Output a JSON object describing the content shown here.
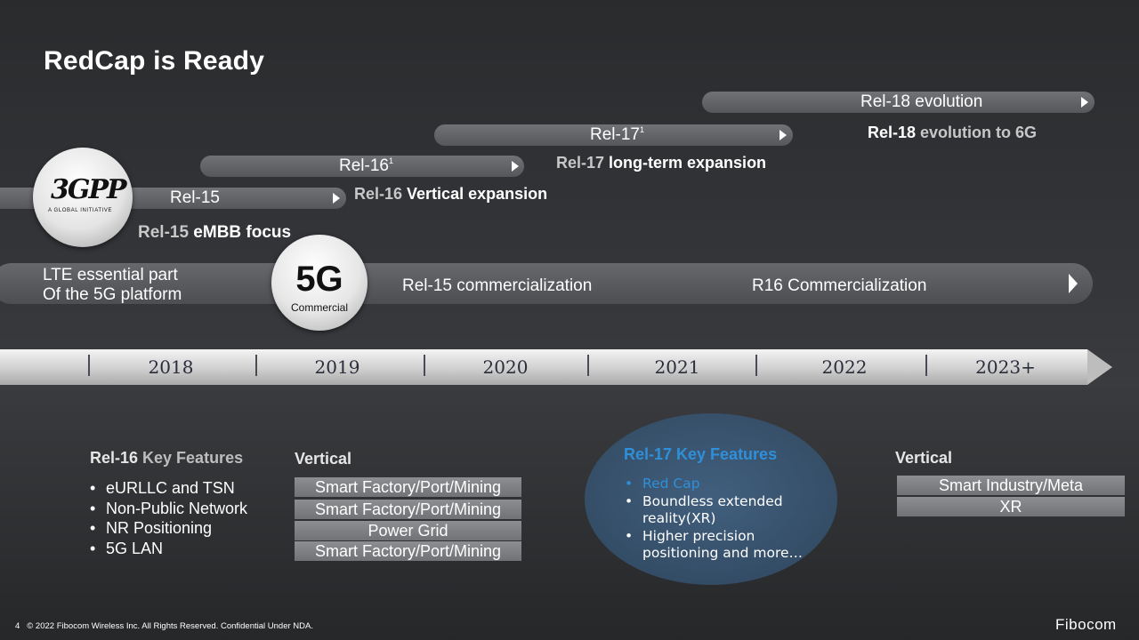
{
  "title": "RedCap is Ready",
  "bars": {
    "rel18": "Rel-18 evolution",
    "rel17": "Rel-17",
    "rel17_sup": "1",
    "rel16": "Rel-16",
    "rel16_sup": "1",
    "rel15": "Rel-15"
  },
  "subtitles": {
    "rel18_prefix": "Rel-18",
    "rel18_text": " evolution to 6G",
    "rel17_prefix": "Rel-17",
    "rel17_text": " long-term expansion",
    "rel16_prefix": "Rel-16",
    "rel16_text": " Vertical expansion",
    "rel15_prefix": "Rel-15",
    "rel15_text": " eMBB focus"
  },
  "logo_3gpp": {
    "mark": "3GPP",
    "tagline": "A GLOBAL INITIATIVE"
  },
  "circle_5g": {
    "big": "5G",
    "small": "Commercial"
  },
  "commercial_bar": {
    "lte_line1": "LTE essential part",
    "lte_line2": "Of the 5G platform",
    "rel15_comm": "Rel-15 commercialization",
    "r16_comm": "R16 Commercialization"
  },
  "timeline": {
    "years": [
      "2018",
      "2019",
      "2020",
      "2021",
      "2022",
      "2023+"
    ]
  },
  "rel16_features": {
    "head_prefix": "Rel-16",
    "head_text": " Key Features",
    "items": [
      "eURLLC and TSN",
      "Non-Public Network",
      "NR Positioning",
      "5G LAN"
    ]
  },
  "vertical_left": {
    "head": "Vertical",
    "boxes": [
      "Smart Factory/Port/Mining",
      "Smart Factory/Port/Mining",
      "Power Grid",
      "Smart Factory/Port/Mining"
    ]
  },
  "rel17_features": {
    "head": "Rel-17 Key Features",
    "item1": "Red Cap",
    "item2_l1": "Boundless extended",
    "item2_l2": "reality(XR)",
    "item3_l1": "Higher precision",
    "item3_l2": "positioning and more…"
  },
  "vertical_right": {
    "head": "Vertical",
    "boxes": [
      "Smart Industry/Meta",
      "XR"
    ]
  },
  "footer": {
    "page": "4",
    "text": "© 2022 Fibocom Wireless Inc. All Rights Reserved. Confidential Under NDA.",
    "brand": "Fibocom"
  }
}
